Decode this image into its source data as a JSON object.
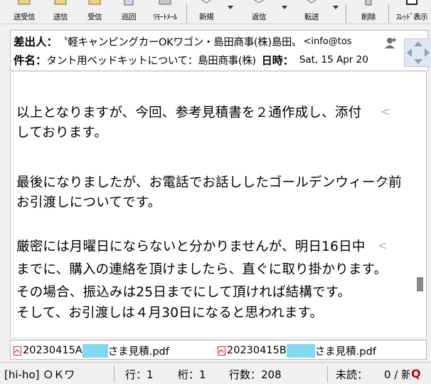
{
  "toolbar": {
    "buttons": [
      {
        "label": "送受信",
        "icon": "send-receive-icon"
      },
      {
        "label": "送信",
        "icon": "send-icon"
      },
      {
        "label": "受信",
        "icon": "receive-icon"
      },
      {
        "label": "巡回",
        "icon": "patrol-icon"
      },
      {
        "label": "ﾘﾓｰﾄﾒｰﾙ",
        "icon": "remote-mail-icon"
      },
      {
        "label": "新規",
        "icon": "new-mail-icon"
      },
      {
        "label": "返信",
        "icon": "reply-icon"
      },
      {
        "label": "転送",
        "icon": "forward-icon"
      },
      {
        "label": "削除",
        "icon": "delete-icon"
      },
      {
        "label": "ｽﾚｯﾄﾞ表示",
        "icon": "thread-view-icon"
      }
    ]
  },
  "header": {
    "from_label": "差出人：",
    "from_value": "〝軽キャンピングカーOKワゴン・島田商事(株)島田〟",
    "from_email": "<info@tos",
    "subject_label": "件名：",
    "subject_value": "タント用ベッドキットについて：島田商事(株)",
    "date_label": "日時：",
    "date_value": "Sat, 15 Apr 20"
  },
  "body": {
    "lines": [
      "以上となりますが、今回、参考見積書を２通作成し、添付",
      "しております。",
      "最後になりましたが、お電話でお話ししたゴールデンウィーク前",
      "お引渡しについてです。",
      "厳密には月曜日にならないと分かりませんが、明日16日中",
      "までに、購入の連絡を頂けましたら、直ぐに取り掛かります。",
      "その場合、振込みは25日までにして頂ければ結構です。",
      "そして、お引渡しは４月30日になると思われます。"
    ],
    "wrap_mark": "<"
  },
  "attachments": [
    {
      "prefix": "20230415A",
      "suffix": "さま見積.pdf"
    },
    {
      "prefix": "20230415B",
      "suffix": "さま見積.pdf"
    }
  ],
  "status": {
    "account": "[hi-ho] ＯＫワ",
    "row": "行：1",
    "col": "桁：1",
    "line_count": "行数：208",
    "unread": "未読：",
    "unread_value": "0 / 新",
    "q_mark": "Q"
  },
  "colors": {
    "redaction": "#82d8f0",
    "pdf_red": "#d21e1e"
  }
}
